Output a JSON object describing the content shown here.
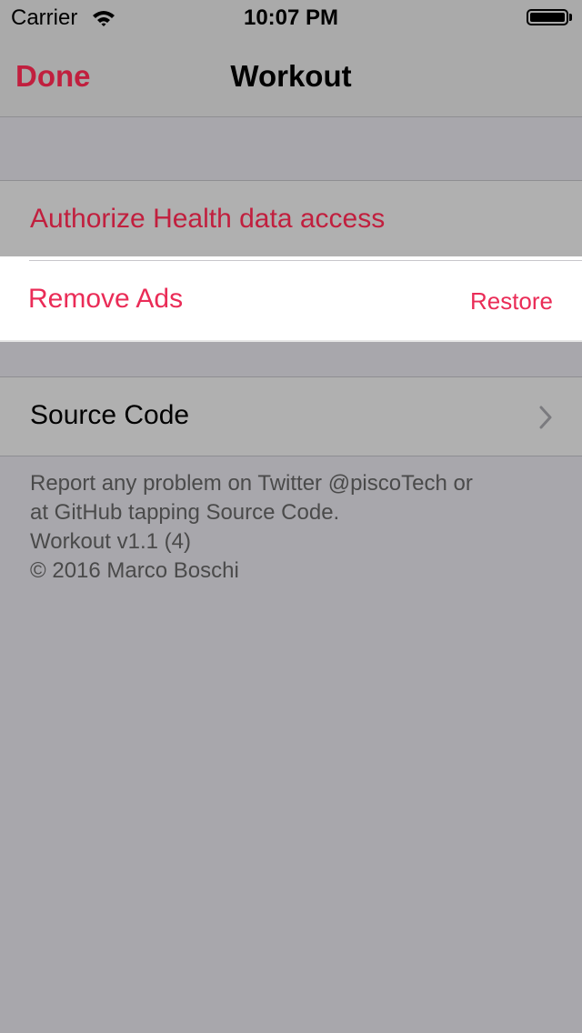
{
  "status_bar": {
    "carrier": "Carrier",
    "time": "10:07 PM",
    "wifi_icon": "wifi-icon",
    "battery_icon": "battery-icon"
  },
  "nav": {
    "done_label": "Done",
    "title": "Workout"
  },
  "settings": {
    "health_label": "Authorize Health data access",
    "remove_ads_label": "Remove Ads",
    "restore_label": "Restore",
    "source_code_label": "Source Code",
    "chevron_icon": "chevron-right-icon"
  },
  "footer": {
    "line1": "Report any problem on Twitter @piscoTech or",
    "line2": "at GitHub tapping Source Code.",
    "line3": "Workout v1.1 (4)",
    "line4": "© 2016 Marco Boschi"
  },
  "colors": {
    "accent": "#c11f3e",
    "accent_bright": "#ea2c57",
    "background": "#a8a7ac"
  }
}
